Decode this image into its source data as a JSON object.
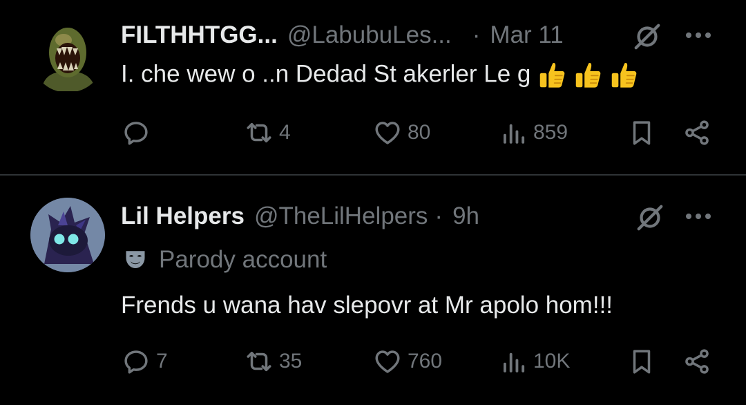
{
  "tweets": [
    {
      "display_name": "FILTHHTGG...",
      "handle": "@LabubuLes...",
      "separator": "·",
      "time": "Mar 11",
      "text": "I. che wew o ..n Dedad St akerler Le g",
      "emoji": [
        "thumbs-up",
        "thumbs-up",
        "thumbs-up"
      ],
      "stats": {
        "replies": "",
        "retweets": "4",
        "likes": "80",
        "views": "859"
      }
    },
    {
      "display_name": "Lil Helpers",
      "handle": "@TheLilHelpers",
      "separator": "·",
      "time": "9h",
      "label": "Parody account",
      "text": "Frends u wana hav slepovr at Mr apolo hom!!!",
      "stats": {
        "replies": "7",
        "retweets": "35",
        "likes": "760",
        "views": "10K"
      }
    }
  ],
  "icons": [
    "reply-icon",
    "retweet-icon",
    "like-icon",
    "views-icon",
    "bookmark-icon",
    "share-icon",
    "grok-icon",
    "more-icon",
    "parody-mask-icon"
  ],
  "colors": {
    "background": "#000000",
    "text": "#e7e9ea",
    "secondary": "#71767b",
    "divider": "#2f3336"
  }
}
